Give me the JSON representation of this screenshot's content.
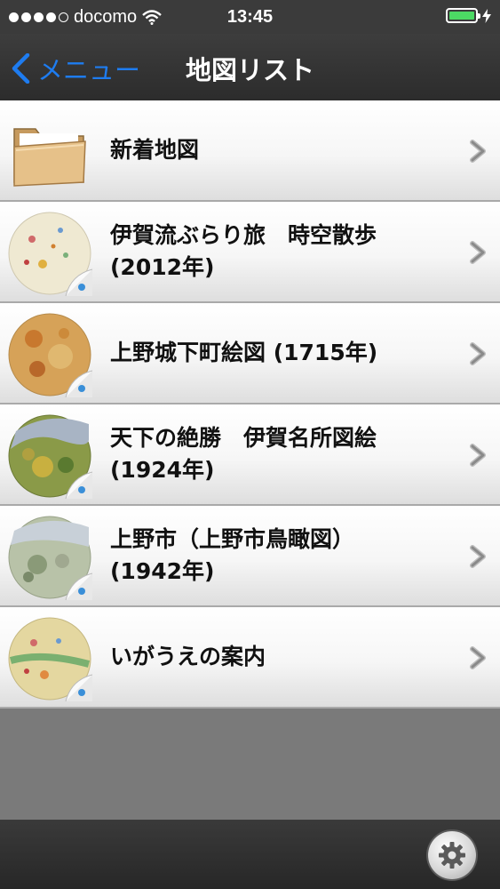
{
  "status_bar": {
    "carrier": "docomo",
    "time": "13:45",
    "signal_bars": 4,
    "battery_level": 1.0,
    "battery_color": "#4cd964"
  },
  "nav_bar": {
    "back_label": "メニュー",
    "title": "地図リスト",
    "accent_color": "#1e7cf0"
  },
  "map_list": [
    {
      "line1": "新着地図",
      "line2": "",
      "icon": "folder-icon"
    },
    {
      "line1": "伊賀流ぶらり旅　時空散歩",
      "line2": "(2012年)",
      "icon": "map-thumbnail-icon"
    },
    {
      "line1": "上野城下町絵図 (1715年)",
      "line2": "",
      "icon": "map-thumbnail-icon"
    },
    {
      "line1": "天下の絶勝　伊賀名所図絵",
      "line2": "(1924年)",
      "icon": "map-thumbnail-icon"
    },
    {
      "line1": "上野市（上野市鳥瞰図）",
      "line2": "(1942年)",
      "icon": "map-thumbnail-icon"
    },
    {
      "line1": "いがうえの案内",
      "line2": "",
      "icon": "map-thumbnail-icon"
    }
  ],
  "toolbar": {
    "settings_icon": "gear-icon"
  }
}
